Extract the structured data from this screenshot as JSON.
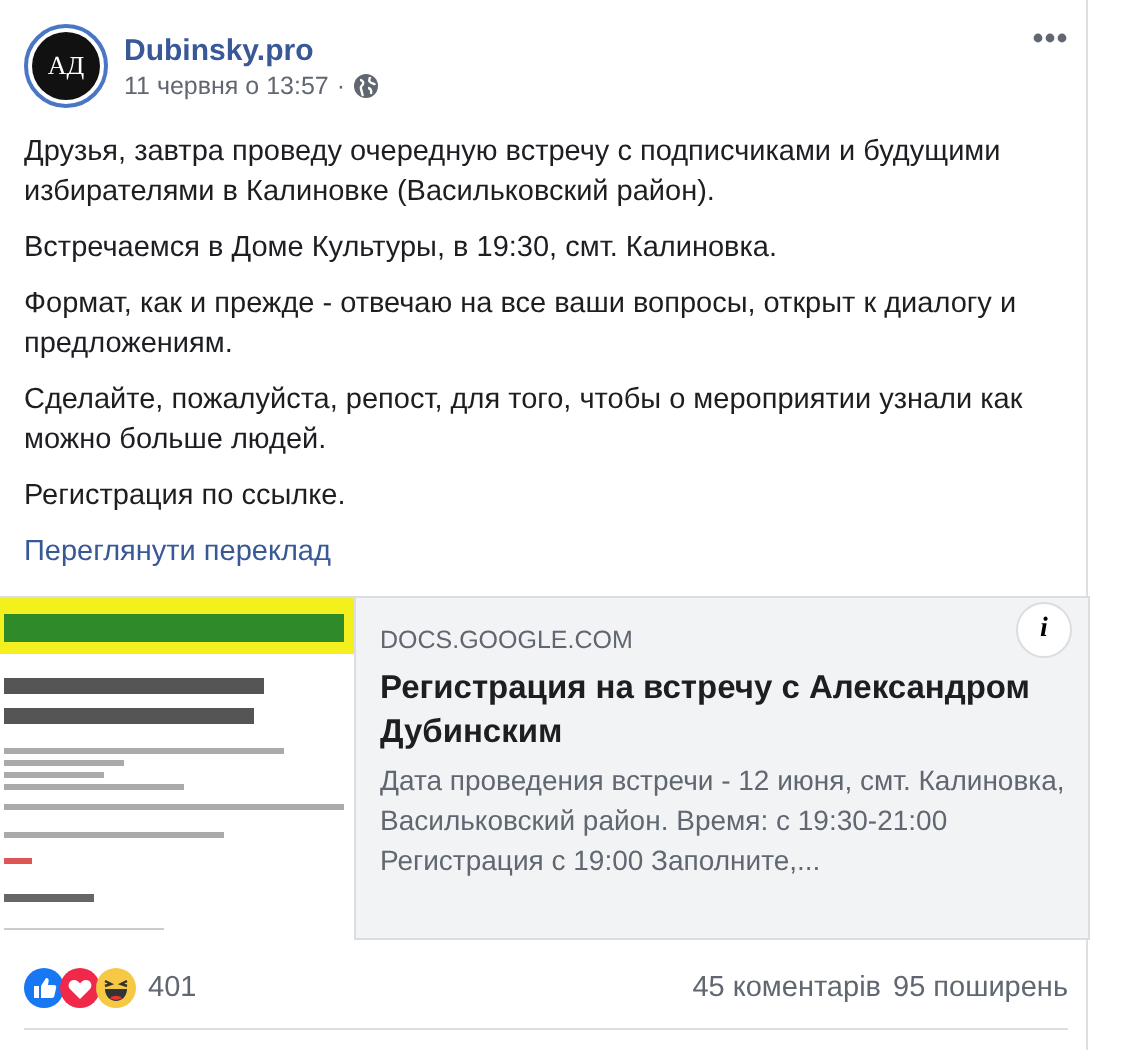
{
  "post": {
    "page_name": "Dubinsky.pro",
    "avatar_text": "АД",
    "timestamp": "11 червня о 13:57",
    "separator": "·",
    "paragraphs": [
      "Друзья, завтра проведу очередную встречу с подписчиками и будущими избирателями в Калиновке (Васильковский район).",
      "Встречаемся в Доме Культуры, в 19:30, смт. Калиновка.",
      "Формат, как и прежде - отвечаю на все ваши вопросы, открыт к диалогу и предложениям.",
      "Сделайте, пожалуйста, репост, для того, чтобы о мероприятии узнали как можно больше людей.",
      "Регистрация по ссылке."
    ],
    "translate_link": "Переглянути переклад"
  },
  "link_preview": {
    "info_button": "i",
    "domain": "DOCS.GOOGLE.COM",
    "title": "Регистрация на встречу с Александром Дубинским",
    "description": "Дата проведения встречи - 12 июня, смт. Калиновка, Васильковский район. Время: с 19:30-21:00 Регистрация с 19:00 Заполните,..."
  },
  "footer": {
    "reaction_count": "401",
    "comments": "45 коментарів",
    "shares": "95 поширень"
  }
}
